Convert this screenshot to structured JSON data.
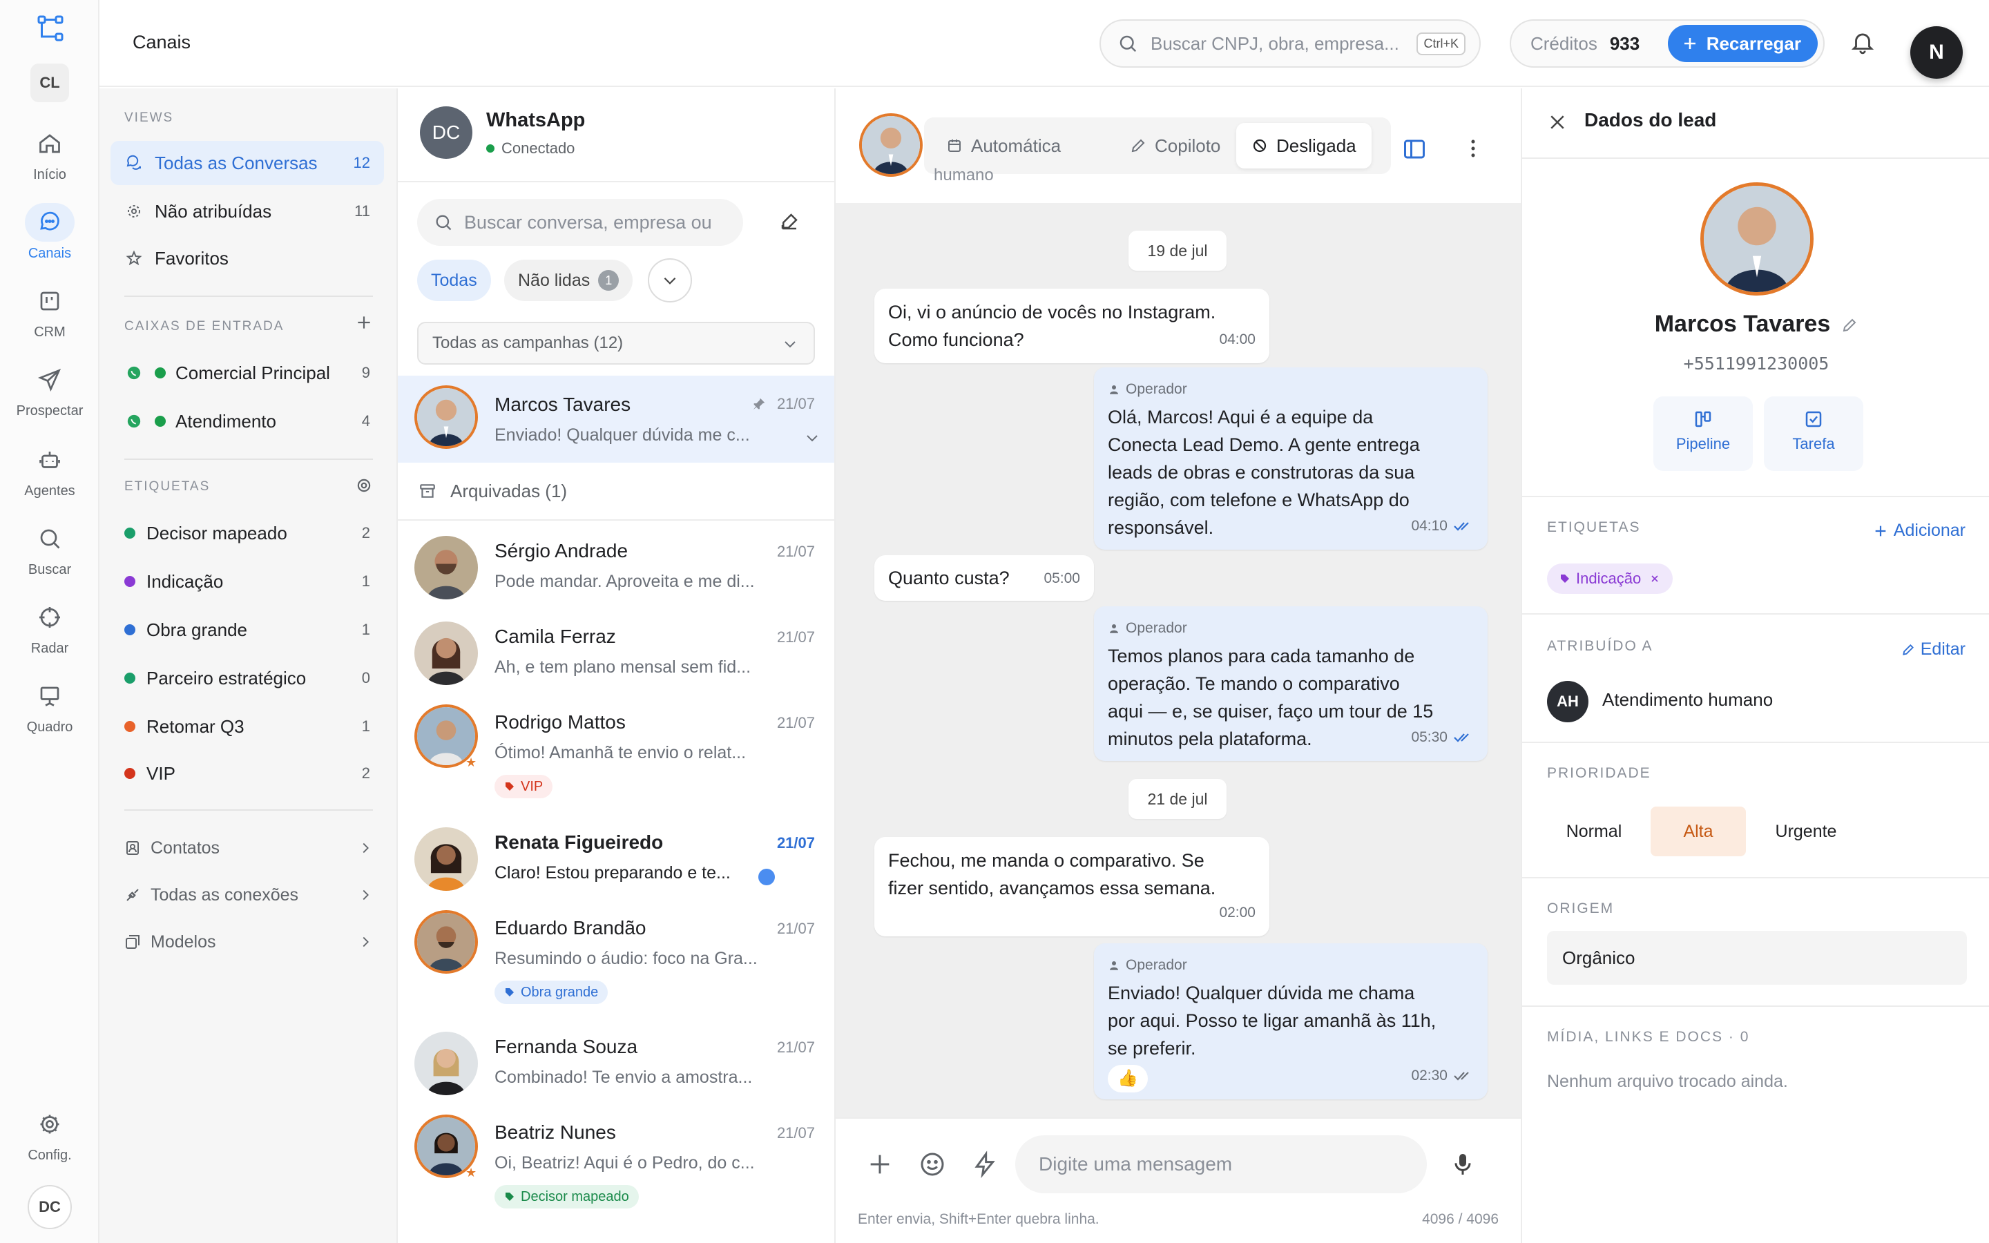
{
  "rail": {
    "workspace_badge": "CL",
    "items": [
      {
        "label": "Início",
        "icon": "home-icon"
      },
      {
        "label": "Canais",
        "icon": "chat-bubble-icon"
      },
      {
        "label": "CRM",
        "icon": "kanban-icon"
      },
      {
        "label": "Prospectar",
        "icon": "send-icon"
      },
      {
        "label": "Agentes",
        "icon": "robot-icon"
      },
      {
        "label": "Buscar",
        "icon": "search-icon"
      },
      {
        "label": "Radar",
        "icon": "crosshair-icon"
      },
      {
        "label": "Quadro",
        "icon": "presentation-icon"
      }
    ],
    "settings_label": "Config.",
    "user_badge": "DC"
  },
  "topbar": {
    "title": "Canais",
    "search_placeholder": "Buscar CNPJ, obra, empresa...",
    "search_shortcut": "Ctrl+K",
    "credits_label": "Créditos",
    "credits_value": "933",
    "recharge_label": "Recarregar",
    "user_initial": "N"
  },
  "views": {
    "views_title": "VIEWS",
    "items": [
      {
        "label": "Todas as Conversas",
        "count": "12"
      },
      {
        "label": "Não atribuídas",
        "count": "11"
      },
      {
        "label": "Favoritos",
        "count": ""
      }
    ],
    "inbox_title": "CAIXAS DE ENTRADA",
    "inboxes": [
      {
        "label": "Comercial Principal",
        "count": "9"
      },
      {
        "label": "Atendimento",
        "count": "4"
      }
    ],
    "tags_title": "ETIQUETAS",
    "tags": [
      {
        "label": "Decisor mapeado",
        "count": "2",
        "color": "#1a9e6a"
      },
      {
        "label": "Indicação",
        "count": "1",
        "color": "#8a3ad4"
      },
      {
        "label": "Obra grande",
        "count": "1",
        "color": "#2f6fd4"
      },
      {
        "label": "Parceiro estratégico",
        "count": "0",
        "color": "#1a9e6a"
      },
      {
        "label": "Retomar Q3",
        "count": "1",
        "color": "#e8622a"
      },
      {
        "label": "VIP",
        "count": "2",
        "color": "#d4351c"
      }
    ],
    "links": [
      {
        "label": "Contatos"
      },
      {
        "label": "Todas as conexões"
      },
      {
        "label": "Modelos"
      }
    ]
  },
  "convlist": {
    "channel_avatar": "DC",
    "channel_name": "WhatsApp",
    "channel_status": "Conectado",
    "search_placeholder": "Buscar conversa, empresa ou",
    "chip_all": "Todas",
    "chip_unread": "Não lidas",
    "chip_unread_count": "1",
    "campaign_select": "Todas as campanhas (12)",
    "archived_label": "Arquivadas (1)",
    "conversations": [
      {
        "name": "Marcos Tavares",
        "date": "21/07",
        "preview": "Enviado! Qualquer dúvida me c...",
        "tag": ""
      },
      {
        "name": "Sérgio Andrade",
        "date": "21/07",
        "preview": "Pode mandar. Aproveita e me di...",
        "tag": ""
      },
      {
        "name": "Camila Ferraz",
        "date": "21/07",
        "preview": "Ah, e tem plano mensal sem fid...",
        "tag": ""
      },
      {
        "name": "Rodrigo Mattos",
        "date": "21/07",
        "preview": "Ótimo! Amanhã te envio o relat...",
        "tag": "VIP"
      },
      {
        "name": "Renata Figueiredo",
        "date": "21/07",
        "preview": "Claro! Estou preparando e te...",
        "tag": ""
      },
      {
        "name": "Eduardo Brandão",
        "date": "21/07",
        "preview": "Resumindo o áudio: foco na Gra...",
        "tag": "Obra grande"
      },
      {
        "name": "Fernanda Souza",
        "date": "21/07",
        "preview": "Combinado! Te envio a amostra...",
        "tag": ""
      },
      {
        "name": "Beatriz Nunes",
        "date": "21/07",
        "preview": "Oi, Beatriz! Aqui é o Pedro, do c...",
        "tag": "Decisor mapeado"
      }
    ]
  },
  "chat": {
    "modes": [
      "Automática",
      "Copiloto",
      "Desligada"
    ],
    "under_label": "humano",
    "day1": "19 de jul",
    "day2": "21 de jul",
    "operator_label": "Operador",
    "messages": [
      {
        "text1": "Oi, vi o anúncio de vocês no Instagram.",
        "text2": "Como funciona?",
        "time": "04:00"
      },
      {
        "lines": [
          "Olá, Marcos! Aqui é a equipe da",
          "Conecta Lead Demo. A gente entrega",
          "leads de obras e construtoras da sua",
          "região, com telefone e WhatsApp do",
          "responsável."
        ],
        "time": "04:10"
      },
      {
        "text1": "Quanto custa?",
        "time": "05:00"
      },
      {
        "lines": [
          "Temos planos para cada tamanho de",
          "operação. Te mando o comparativo",
          "aqui — e, se quiser, faço um tour de 15",
          "minutos pela plataforma."
        ],
        "time": "05:30"
      },
      {
        "text1": "Fechou, me manda o comparativo. Se",
        "text2": "fizer sentido, avançamos essa semana.",
        "time": "02:00"
      },
      {
        "lines": [
          "Enviado! Qualquer dúvida me chama",
          "por aqui. Posso te ligar amanhã às 11h,",
          "se preferir."
        ],
        "time": "02:30",
        "reaction": "👍"
      }
    ],
    "input_placeholder": "Digite uma mensagem",
    "hint": "Enter envia, Shift+Enter quebra linha.",
    "counter": "4096 / 4096"
  },
  "lead": {
    "title": "Dados do lead",
    "name": "Marcos Tavares",
    "phone": "+5511991230005",
    "action_pipeline": "Pipeline",
    "action_task": "Tarefa",
    "tags_title": "ETIQUETAS",
    "add_label": "Adicionar",
    "tag": "Indicação",
    "assigned_title": "ATRIBUÍDO A",
    "edit_label": "Editar",
    "assignee_initials": "AH",
    "assignee_name": "Atendimento humano",
    "priority_title": "PRIORIDADE",
    "priorities": [
      "Normal",
      "Alta",
      "Urgente"
    ],
    "origin_title": "ORIGEM",
    "origin_value": "Orgânico",
    "media_title": "MÍDIA, LINKS E DOCS · 0",
    "media_empty": "Nenhum arquivo trocado ainda."
  },
  "colors": {
    "accent": "#2f80ed",
    "ring": "#e37a2b",
    "priority_active": "#fcebdf"
  }
}
